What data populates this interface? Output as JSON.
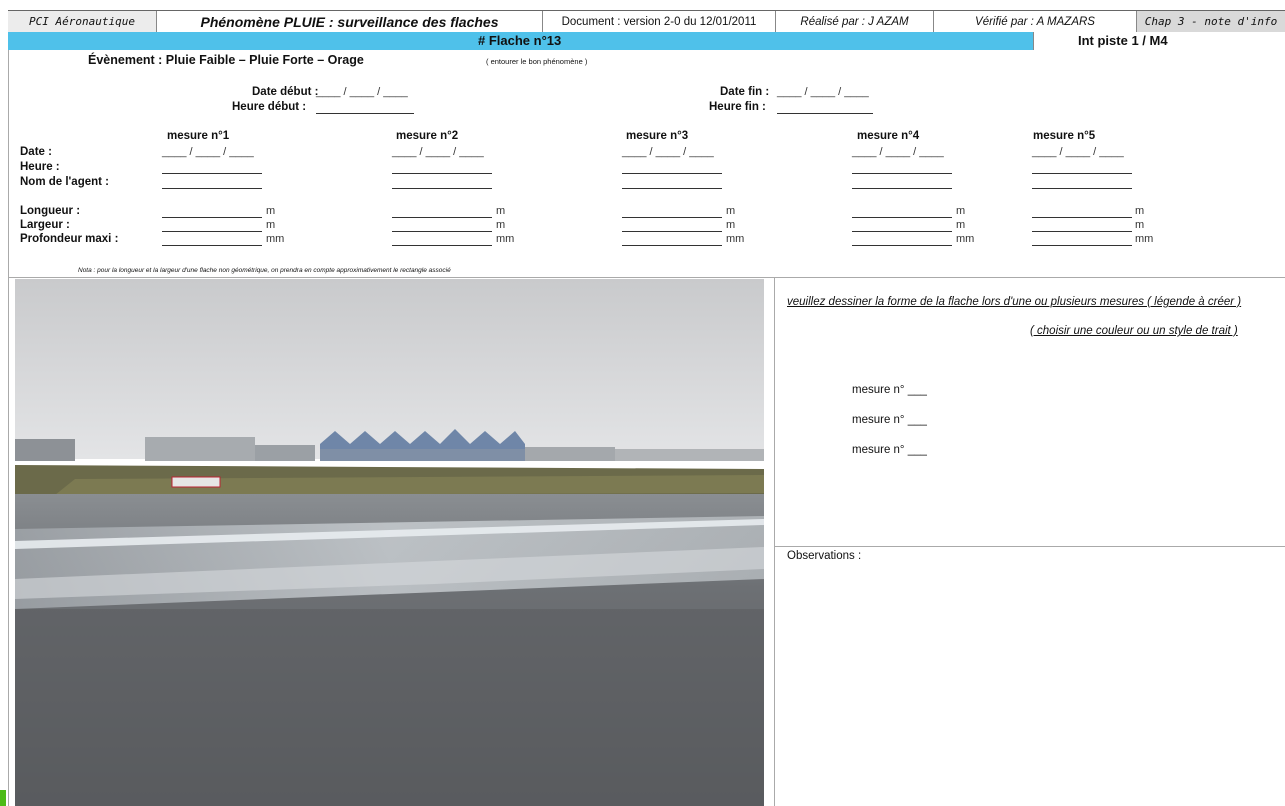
{
  "header": {
    "organisation": "PCI Aéronautique",
    "title": "Phénomène PLUIE : surveillance des flaches",
    "document": "Document :  version 2-0 du 12/01/2011",
    "realise": "Réalisé par : J AZAM",
    "verifie": "Vérifié par : A MAZARS",
    "chapter": "Chap 3 - note d'info"
  },
  "band": {
    "flache": "# Flache n°13",
    "piste": "Int piste 1 / M4"
  },
  "event": {
    "label": "Évènement : Pluie Faible – Pluie Forte – Orage",
    "hint": "( entourer le bon phénomène )"
  },
  "dates": {
    "date_debut_label": "Date début :",
    "heure_debut_label": "Heure début :",
    "date_fin_label": "Date fin :",
    "heure_fin_label": "Heure fin :",
    "date_blank": "____ / ____ / ____"
  },
  "measures": {
    "headers": [
      "mesure n°1",
      "mesure n°2",
      "mesure n°3",
      "mesure n°4",
      "mesure n°5"
    ],
    "row_labels": {
      "date": "Date :",
      "heure": "Heure :",
      "agent": "Nom de l'agent :",
      "longueur": "Longueur :",
      "largeur": "Largeur :",
      "profondeur": "Profondeur maxi :"
    },
    "date_blank": "____ / ____ / ____",
    "unit_m": "m",
    "unit_mm": "mm"
  },
  "note": "Nota : pour la longueur et la largeur d'une flache non géométrique, on prendra en compte approximativement le rectangle associé",
  "drawing": {
    "instruction": "veuillez dessiner la forme de la flache lors d'une ou plusieurs mesures ( légende à créer )",
    "instruction2": "( choisir une couleur ou un style de trait )",
    "legend": [
      "mesure n° ___",
      "mesure n° ___",
      "mesure n° ___"
    ]
  },
  "observations": "Observations :",
  "colors": {
    "band": "#4fc1ea",
    "header_gray": "#ececec"
  }
}
